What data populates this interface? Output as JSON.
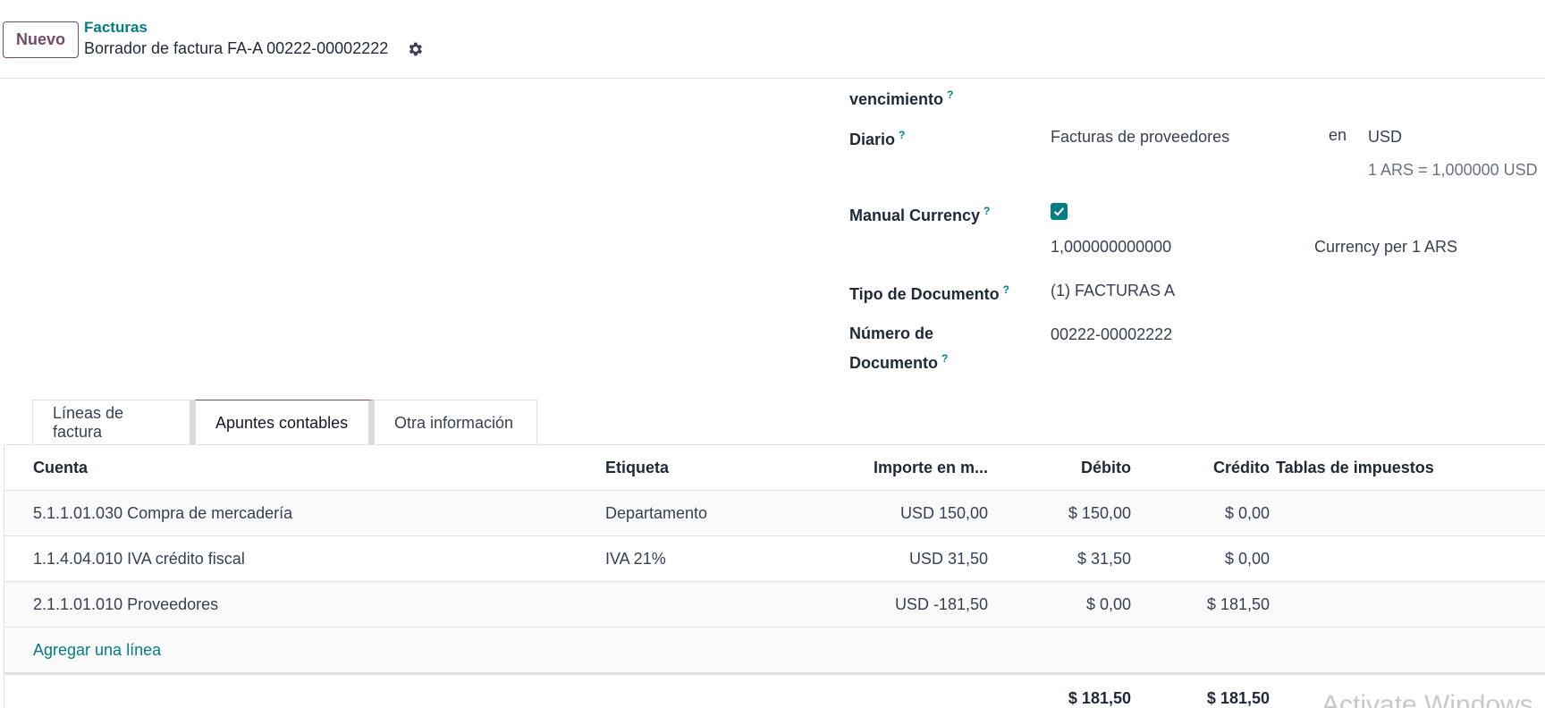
{
  "toolbar": {
    "new_label": "Nuevo"
  },
  "breadcrumb": {
    "parent": "Facturas",
    "current": "Borrador de factura FA-A 00222-00002222"
  },
  "icons": {
    "settings": "gear-icon",
    "check": "check-icon"
  },
  "colors": {
    "accent": "#017e84",
    "brand": "#714b67"
  },
  "form": {
    "vencimiento_label": "vencimiento",
    "diario": {
      "label": "Diario",
      "value": "Facturas de proveedores",
      "in_label": "en",
      "currency": "USD",
      "rate": "1 ARS = 1,000000 USD"
    },
    "manual_currency": {
      "label": "Manual Currency",
      "checked": true,
      "rate_value": "1,000000000000",
      "rate_unit": "Currency per 1 ARS"
    },
    "tipo_documento": {
      "label": "Tipo de Documento",
      "value": "(1) FACTURAS A"
    },
    "numero_documento": {
      "label_line1": "Número de",
      "label_line2": "Documento",
      "value": "00222-00002222"
    },
    "help_mark": "?"
  },
  "tabs": [
    {
      "label": "Líneas de factura"
    },
    {
      "label": "Apuntes contables"
    },
    {
      "label": "Otra información"
    }
  ],
  "table": {
    "headers": {
      "cuenta": "Cuenta",
      "etiqueta": "Etiqueta",
      "importe": "Importe en m...",
      "debito": "Débito",
      "credito": "Crédito",
      "tablas": "Tablas de impuestos"
    },
    "rows": [
      {
        "cuenta": "5.1.1.01.030 Compra de mercadería",
        "etiqueta": "Departamento",
        "importe": "USD 150,00",
        "debito": "$ 150,00",
        "credito": "$ 0,00"
      },
      {
        "cuenta": "1.1.4.04.010 IVA crédito fiscal",
        "etiqueta": "IVA 21%",
        "importe": "USD 31,50",
        "debito": "$ 31,50",
        "credito": "$ 0,00"
      },
      {
        "cuenta": "2.1.1.01.010 Proveedores",
        "etiqueta": "",
        "importe": "USD -181,50",
        "debito": "$ 0,00",
        "credito": "$ 181,50"
      }
    ],
    "add_line": "Agregar una línea",
    "totals": {
      "debito": "$ 181,50",
      "credito": "$ 181,50"
    }
  },
  "watermark": "Activate Windows"
}
